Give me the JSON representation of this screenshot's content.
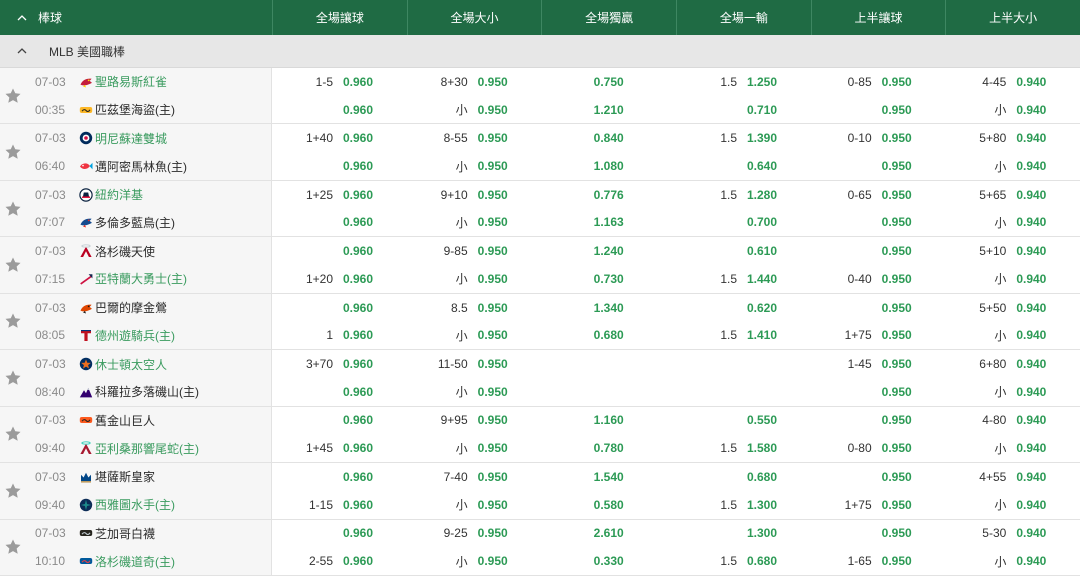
{
  "colors": {
    "header_bg": "#1f6b44",
    "odds": "#2c9a55",
    "team_highlight": "#3a9b5f",
    "team_default": "#2b2b2b"
  },
  "header": {
    "sport_label": "棒球",
    "columns": [
      "全場讓球",
      "全場大小",
      "全場獨贏",
      "全場一輸",
      "上半讓球",
      "上半大小"
    ]
  },
  "league": {
    "name": "MLB 美國職棒"
  },
  "matches": [
    {
      "date": "07-03",
      "time": "00:35",
      "teams": [
        {
          "name": "聖路易斯紅雀",
          "name_color": "#3a9b5f",
          "logo": {
            "icon": "cardinals-logo-icon",
            "colors": [
              "#c41e3a",
              "#fedb00"
            ]
          },
          "cells": [
            {
              "line": "1-5",
              "odds": "0.960"
            },
            {
              "line": "8+30",
              "odds": "0.950"
            },
            {
              "odds": "0.750"
            },
            {
              "line": "1.5",
              "odds": "1.250"
            },
            {
              "line": "0-85",
              "odds": "0.950"
            },
            {
              "line": "4-45",
              "odds": "0.940"
            }
          ]
        },
        {
          "name": "匹茲堡海盜(主)",
          "name_color": "#2b2b2b",
          "logo": {
            "icon": "pirates-logo-icon",
            "colors": [
              "#fdb827",
              "#27251f"
            ]
          },
          "cells": [
            {
              "odds": "0.960"
            },
            {
              "line": "小",
              "odds": "0.950"
            },
            {
              "odds": "1.210"
            },
            {
              "odds": "0.710"
            },
            {
              "odds": "0.950"
            },
            {
              "line": "小",
              "odds": "0.940"
            }
          ]
        }
      ]
    },
    {
      "date": "07-03",
      "time": "06:40",
      "teams": [
        {
          "name": "明尼蘇達雙城",
          "name_color": "#3a9b5f",
          "logo": {
            "icon": "twins-logo-icon",
            "colors": [
              "#002b5c",
              "#d31145"
            ]
          },
          "cells": [
            {
              "line": "1+40",
              "odds": "0.960"
            },
            {
              "line": "8-55",
              "odds": "0.950"
            },
            {
              "odds": "0.840"
            },
            {
              "line": "1.5",
              "odds": "1.390"
            },
            {
              "line": "0-10",
              "odds": "0.950"
            },
            {
              "line": "5+80",
              "odds": "0.940"
            }
          ]
        },
        {
          "name": "邁阿密馬林魚(主)",
          "name_color": "#2b2b2b",
          "logo": {
            "icon": "marlins-logo-icon",
            "colors": [
              "#ef3340",
              "#00a3e0"
            ]
          },
          "cells": [
            {
              "odds": "0.960"
            },
            {
              "line": "小",
              "odds": "0.950"
            },
            {
              "odds": "1.080"
            },
            {
              "odds": "0.640"
            },
            {
              "odds": "0.950"
            },
            {
              "line": "小",
              "odds": "0.940"
            }
          ]
        }
      ]
    },
    {
      "date": "07-03",
      "time": "07:07",
      "teams": [
        {
          "name": "紐約洋基",
          "name_color": "#3a9b5f",
          "logo": {
            "icon": "yankees-logo-icon",
            "colors": [
              "#0c2340",
              "#e4002c"
            ]
          },
          "cells": [
            {
              "line": "1+25",
              "odds": "0.960"
            },
            {
              "line": "9+10",
              "odds": "0.950"
            },
            {
              "odds": "0.776"
            },
            {
              "line": "1.5",
              "odds": "1.280"
            },
            {
              "line": "0-65",
              "odds": "0.950"
            },
            {
              "line": "5+65",
              "odds": "0.940"
            }
          ]
        },
        {
          "name": "多倫多藍鳥(主)",
          "name_color": "#2b2b2b",
          "logo": {
            "icon": "blue-jays-logo-icon",
            "colors": [
              "#134a8e",
              "#e8291c"
            ]
          },
          "cells": [
            {
              "odds": "0.960"
            },
            {
              "line": "小",
              "odds": "0.950"
            },
            {
              "odds": "1.163"
            },
            {
              "odds": "0.700"
            },
            {
              "odds": "0.950"
            },
            {
              "line": "小",
              "odds": "0.940"
            }
          ]
        }
      ]
    },
    {
      "date": "07-03",
      "time": "07:15",
      "teams": [
        {
          "name": "洛杉磯天使",
          "name_color": "#2b2b2b",
          "logo": {
            "icon": "angels-logo-icon",
            "colors": [
              "#ba0021",
              "#c4ced4"
            ]
          },
          "cells": [
            {
              "odds": "0.960"
            },
            {
              "line": "9-85",
              "odds": "0.950"
            },
            {
              "odds": "1.240"
            },
            {
              "odds": "0.610"
            },
            {
              "odds": "0.950"
            },
            {
              "line": "5+10",
              "odds": "0.940"
            }
          ]
        },
        {
          "name": "亞特蘭大勇士(主)",
          "name_color": "#3a9b5f",
          "logo": {
            "icon": "braves-logo-icon",
            "colors": [
              "#ce1141",
              "#13274f"
            ]
          },
          "cells": [
            {
              "line": "1+20",
              "odds": "0.960"
            },
            {
              "line": "小",
              "odds": "0.950"
            },
            {
              "odds": "0.730"
            },
            {
              "line": "1.5",
              "odds": "1.440"
            },
            {
              "line": "0-40",
              "odds": "0.950"
            },
            {
              "line": "小",
              "odds": "0.940"
            }
          ]
        }
      ]
    },
    {
      "date": "07-03",
      "time": "08:05",
      "teams": [
        {
          "name": "巴爾的摩金鶯",
          "name_color": "#2b2b2b",
          "logo": {
            "icon": "orioles-logo-icon",
            "colors": [
              "#df4601",
              "#1a1a1a"
            ]
          },
          "cells": [
            {
              "odds": "0.960"
            },
            {
              "line": "8.5",
              "odds": "0.950"
            },
            {
              "odds": "1.340"
            },
            {
              "odds": "0.620"
            },
            {
              "odds": "0.950"
            },
            {
              "line": "5+50",
              "odds": "0.940"
            }
          ]
        },
        {
          "name": "德州遊騎兵(主)",
          "name_color": "#3a9b5f",
          "logo": {
            "icon": "rangers-logo-icon",
            "colors": [
              "#c0111f",
              "#003278"
            ]
          },
          "cells": [
            {
              "line": "1",
              "odds": "0.960"
            },
            {
              "line": "小",
              "odds": "0.950"
            },
            {
              "odds": "0.680"
            },
            {
              "line": "1.5",
              "odds": "1.410"
            },
            {
              "line": "1+75",
              "odds": "0.950"
            },
            {
              "line": "小",
              "odds": "0.940"
            }
          ]
        }
      ]
    },
    {
      "date": "07-03",
      "time": "08:40",
      "teams": [
        {
          "name": "休士頓太空人",
          "name_color": "#3a9b5f",
          "logo": {
            "icon": "astros-logo-icon",
            "colors": [
              "#eb6e1f",
              "#002d62"
            ]
          },
          "cells": [
            {
              "line": "3+70",
              "odds": "0.960"
            },
            {
              "line": "11-50",
              "odds": "0.950"
            },
            {},
            {},
            {
              "line": "1-45",
              "odds": "0.950"
            },
            {
              "line": "6+80",
              "odds": "0.940"
            }
          ]
        },
        {
          "name": "科羅拉多落磯山(主)",
          "name_color": "#2b2b2b",
          "logo": {
            "icon": "rockies-logo-icon",
            "colors": [
              "#33006f",
              "#c4ced4"
            ]
          },
          "cells": [
            {
              "odds": "0.960"
            },
            {
              "line": "小",
              "odds": "0.950"
            },
            {},
            {},
            {
              "odds": "0.950"
            },
            {
              "line": "小",
              "odds": "0.940"
            }
          ]
        }
      ]
    },
    {
      "date": "07-03",
      "time": "09:40",
      "teams": [
        {
          "name": "舊金山巨人",
          "name_color": "#2b2b2b",
          "logo": {
            "icon": "giants-logo-icon",
            "colors": [
              "#fd5a1e",
              "#27251f"
            ]
          },
          "cells": [
            {
              "odds": "0.960"
            },
            {
              "line": "9+95",
              "odds": "0.950"
            },
            {
              "odds": "1.160"
            },
            {
              "odds": "0.550"
            },
            {
              "odds": "0.950"
            },
            {
              "line": "4-80",
              "odds": "0.940"
            }
          ]
        },
        {
          "name": "亞利桑那響尾蛇(主)",
          "name_color": "#3a9b5f",
          "logo": {
            "icon": "diamondbacks-logo-icon",
            "colors": [
              "#a71930",
              "#30ceb8"
            ]
          },
          "cells": [
            {
              "line": "1+45",
              "odds": "0.960"
            },
            {
              "line": "小",
              "odds": "0.950"
            },
            {
              "odds": "0.780"
            },
            {
              "line": "1.5",
              "odds": "1.580"
            },
            {
              "line": "0-80",
              "odds": "0.950"
            },
            {
              "line": "小",
              "odds": "0.940"
            }
          ]
        }
      ]
    },
    {
      "date": "07-03",
      "time": "09:40",
      "teams": [
        {
          "name": "堪薩斯皇家",
          "name_color": "#2b2b2b",
          "logo": {
            "icon": "royals-logo-icon",
            "colors": [
              "#004687",
              "#bd9b60"
            ]
          },
          "cells": [
            {
              "odds": "0.960"
            },
            {
              "line": "7-40",
              "odds": "0.950"
            },
            {
              "odds": "1.540"
            },
            {
              "odds": "0.680"
            },
            {
              "odds": "0.950"
            },
            {
              "line": "4+55",
              "odds": "0.940"
            }
          ]
        },
        {
          "name": "西雅圖水手(主)",
          "name_color": "#3a9b5f",
          "logo": {
            "icon": "mariners-logo-icon",
            "colors": [
              "#0c2c56",
              "#1d8a8a"
            ]
          },
          "cells": [
            {
              "line": "1-15",
              "odds": "0.960"
            },
            {
              "line": "小",
              "odds": "0.950"
            },
            {
              "odds": "0.580"
            },
            {
              "line": "1.5",
              "odds": "1.300"
            },
            {
              "line": "1+75",
              "odds": "0.950"
            },
            {
              "line": "小",
              "odds": "0.940"
            }
          ]
        }
      ]
    },
    {
      "date": "07-03",
      "time": "10:10",
      "teams": [
        {
          "name": "芝加哥白襪",
          "name_color": "#2b2b2b",
          "logo": {
            "icon": "white-sox-logo-icon",
            "colors": [
              "#27251f",
              "#c4ced4"
            ]
          },
          "cells": [
            {
              "odds": "0.960"
            },
            {
              "line": "9-25",
              "odds": "0.950"
            },
            {
              "odds": "2.610"
            },
            {
              "odds": "1.300"
            },
            {
              "odds": "0.950"
            },
            {
              "line": "5-30",
              "odds": "0.940"
            }
          ]
        },
        {
          "name": "洛杉磯道奇(主)",
          "name_color": "#3a9b5f",
          "logo": {
            "icon": "dodgers-logo-icon",
            "colors": [
              "#005a9c",
              "#ef3e42"
            ]
          },
          "cells": [
            {
              "line": "2-55",
              "odds": "0.960"
            },
            {
              "line": "小",
              "odds": "0.950"
            },
            {
              "odds": "0.330"
            },
            {
              "line": "1.5",
              "odds": "0.680"
            },
            {
              "line": "1-65",
              "odds": "0.950"
            },
            {
              "line": "小",
              "odds": "0.940"
            }
          ]
        }
      ]
    }
  ]
}
